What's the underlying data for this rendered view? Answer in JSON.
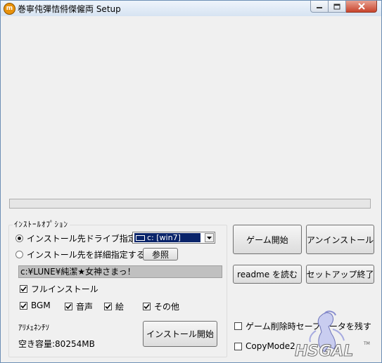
{
  "window": {
    "title": "巻寧伅彈恄偫傑僱両 Setup"
  },
  "group": {
    "label": "ｲﾝｽﾄｰﾙｵﾌﾟｼｮﾝ"
  },
  "radio_drive": {
    "label": "インストール先ドライブ指定",
    "checked": true
  },
  "drive_select": {
    "value": "c: [win7]"
  },
  "radio_detail": {
    "label": "インストール先を詳細指定する",
    "checked": false
  },
  "browse_button": {
    "label": "参照"
  },
  "install_path": {
    "value": "c:¥LUNE¥純潔★女神さまっ！"
  },
  "full_install": {
    "label": "フルインストール",
    "checked": true
  },
  "components": [
    {
      "label": "BGM",
      "checked": true
    },
    {
      "label": "音声",
      "checked": true
    },
    {
      "label": "絵",
      "checked": true
    },
    {
      "label": "その他",
      "checked": true
    }
  ],
  "space_label": "ｱﾘﾒｪﾈﾝﾁｿ",
  "free_space": "空き容量:80254MB",
  "buttons": {
    "install": "インストール開始",
    "start_game": "ゲーム開始",
    "uninstall": "アンインストール",
    "readme": "readme を読む",
    "exit_setup": "セットアップ終了"
  },
  "keep_save": {
    "label": "ゲーム削除時セーブデータを残す",
    "checked": false
  },
  "copymode": {
    "label": "CopyMode2",
    "checked": false
  },
  "progress": {
    "value": 0
  },
  "logo": {
    "text": "HSGAL",
    "tm": "TM"
  },
  "colors": {
    "selection": "#0a246a",
    "close_button": "#c8442c",
    "title_gradient_top": "#eef4fb"
  }
}
